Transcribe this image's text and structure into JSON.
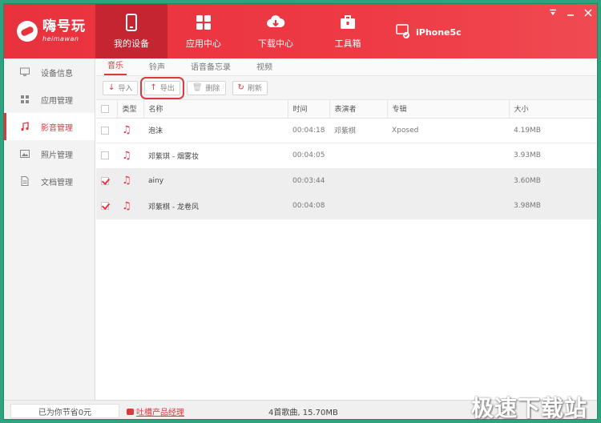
{
  "app": {
    "logo_text": "嗨号玩",
    "logo_sub": "heimawan"
  },
  "nav": [
    {
      "label": "我的设备",
      "icon": "phone-icon",
      "active": true
    },
    {
      "label": "应用中心",
      "icon": "apps-grid-icon",
      "active": false
    },
    {
      "label": "下载中心",
      "icon": "cloud-download-icon",
      "active": false
    },
    {
      "label": "工具箱",
      "icon": "toolbox-icon",
      "active": false
    }
  ],
  "device": {
    "label": "iPhone5c",
    "icon": "device-phone-check-icon"
  },
  "sidebar": [
    {
      "label": "设备信息",
      "icon": "monitor-icon",
      "active": false
    },
    {
      "label": "应用管理",
      "icon": "grid-icon",
      "active": false
    },
    {
      "label": "影音管理",
      "icon": "music-note-icon",
      "active": true
    },
    {
      "label": "照片管理",
      "icon": "image-icon",
      "active": false
    },
    {
      "label": "文档管理",
      "icon": "document-icon",
      "active": false
    }
  ],
  "subtabs": [
    {
      "label": "音乐",
      "active": true
    },
    {
      "label": "铃声",
      "active": false
    },
    {
      "label": "语音备忘录",
      "active": false
    },
    {
      "label": "视频",
      "active": false
    }
  ],
  "toolbar": {
    "import": "导入",
    "export": "导出",
    "delete": "删除",
    "refresh": "刷新"
  },
  "table": {
    "headers": {
      "type": "类型",
      "name": "名称",
      "time": "时间",
      "artist": "表演者",
      "album": "专辑",
      "size": "大小"
    },
    "rows": [
      {
        "name": "泡沫",
        "time": "00:04:18",
        "artist": "邓紫棋",
        "album": "Xposed",
        "size": "4.19MB",
        "checked": false
      },
      {
        "name": "邓紫琪 - 烟雾妆",
        "time": "00:04:05",
        "artist": "",
        "album": "",
        "size": "3.93MB",
        "checked": false
      },
      {
        "name": "ainy",
        "time": "00:03:44",
        "artist": "",
        "album": "",
        "size": "3.60MB",
        "checked": true
      },
      {
        "name": "邓紫棋 - 龙卷风",
        "time": "00:04:08",
        "artist": "",
        "album": "",
        "size": "3.98MB",
        "checked": true
      }
    ]
  },
  "status": {
    "saved": "已为你节省0元",
    "feedback": "吐槽产品经理",
    "summary": "4首歌曲, 15.70MB",
    "watermark": "极速下载站"
  },
  "colors": {
    "accent": "#e8323e",
    "accent_dark": "#c42530",
    "frame": "#2fa37f"
  }
}
